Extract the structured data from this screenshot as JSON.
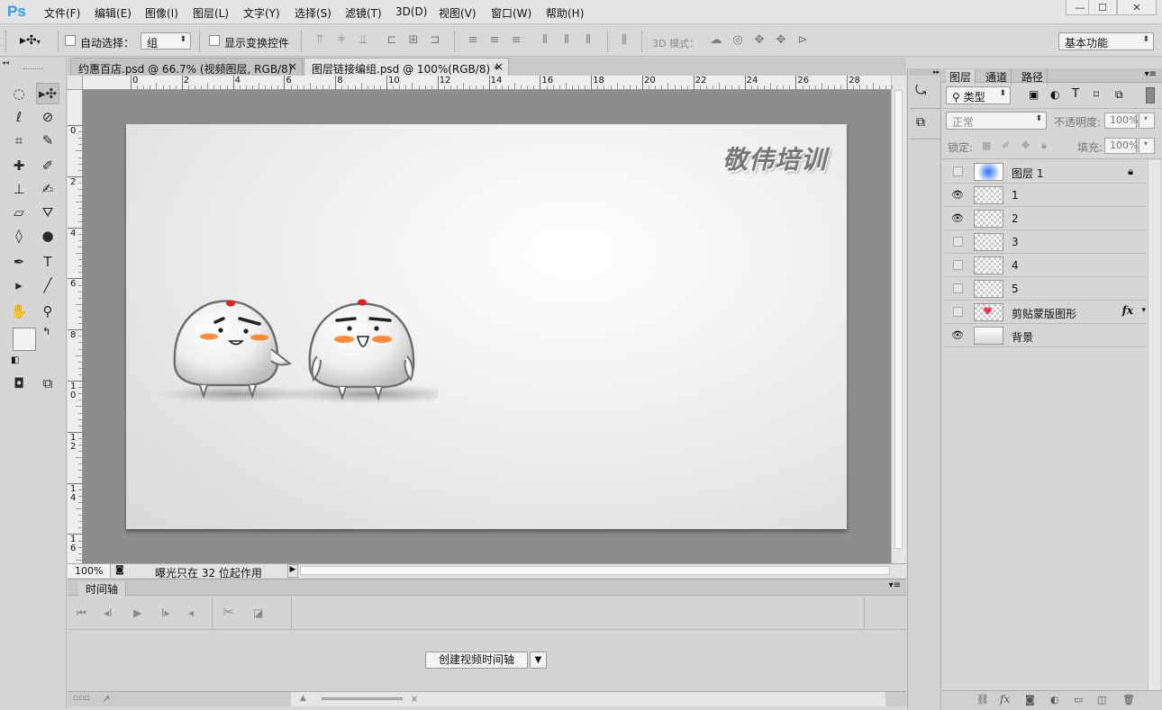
{
  "app": {
    "logo": "Ps"
  },
  "menu": [
    "文件(F)",
    "编辑(E)",
    "图像(I)",
    "图层(L)",
    "文字(Y)",
    "选择(S)",
    "滤镜(T)",
    "3D(D)",
    "视图(V)",
    "窗口(W)",
    "帮助(H)"
  ],
  "window_controls": {
    "minimize": "—",
    "maximize": "☐",
    "close": "✕"
  },
  "options": {
    "auto_select_label": "自动选择：",
    "auto_select_value": "组",
    "show_transform_label": "显示变换控件",
    "mode_3d_label": "3D 模式：",
    "workspace": "基本功能"
  },
  "tabs": [
    {
      "title": "约惠百店.psd @ 66.7% (视频图层, RGB/8)",
      "close": "×"
    },
    {
      "title": "图层链接编组.psd @ 100%(RGB/8) *",
      "close": "×"
    }
  ],
  "ruler": {
    "h_ticks": [
      "0",
      "2",
      "4",
      "6",
      "8",
      "10",
      "12",
      "14",
      "16",
      "18",
      "20",
      "22",
      "24",
      "26",
      "28"
    ],
    "v_ticks": [
      "0",
      "2",
      "4",
      "6",
      "8",
      "10",
      "12",
      "14",
      "16"
    ]
  },
  "canvas": {
    "watermark": "敬伟培训"
  },
  "status": {
    "zoom": "100%",
    "message": "曝光只在 32 位起作用"
  },
  "timeline": {
    "tab": "时间轴",
    "create_button": "创建视频时间轴"
  },
  "layers_panel": {
    "tabs": [
      "图层",
      "通道",
      "路径"
    ],
    "filter_kind": "类型",
    "blend_mode": "正常",
    "opacity_label": "不透明度:",
    "opacity_value": "100%",
    "lock_label": "锁定:",
    "fill_label": "填充:",
    "fill_value": "100%",
    "fx_label": "fx",
    "layers": [
      {
        "name": "图层 1",
        "visible": false,
        "locked": true
      },
      {
        "name": "1",
        "visible": true
      },
      {
        "name": "2",
        "visible": true
      },
      {
        "name": "3",
        "visible": false
      },
      {
        "name": "4",
        "visible": false
      },
      {
        "name": "5",
        "visible": false
      },
      {
        "name": "剪贴蒙版图形",
        "visible": false,
        "fx": true
      },
      {
        "name": "背景",
        "visible": true
      }
    ]
  },
  "colors": {
    "ps_blue": "#31a8ff",
    "orange_cheek": "#ff7a1a",
    "red_dot": "#e02020"
  }
}
